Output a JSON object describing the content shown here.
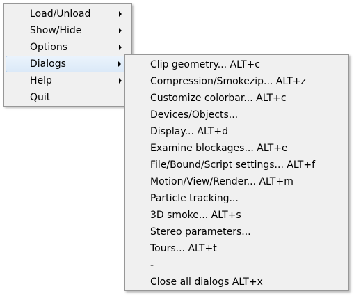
{
  "main_menu": {
    "items": [
      {
        "label": "Load/Unload",
        "has_submenu": true
      },
      {
        "label": "Show/Hide",
        "has_submenu": true
      },
      {
        "label": "Options",
        "has_submenu": true
      },
      {
        "label": "Dialogs",
        "has_submenu": true,
        "highlighted": true
      },
      {
        "label": "Help",
        "has_submenu": true
      },
      {
        "label": "Quit",
        "has_submenu": false
      }
    ]
  },
  "dialogs_submenu": {
    "items": [
      {
        "label": "Clip geometry...  ALT+c"
      },
      {
        "label": "Compression/Smokezip...  ALT+z"
      },
      {
        "label": "Customize colorbar...  ALT+c"
      },
      {
        "label": "Devices/Objects..."
      },
      {
        "label": "Display...  ALT+d"
      },
      {
        "label": "Examine blockages...  ALT+e"
      },
      {
        "label": "File/Bound/Script settings...  ALT+f"
      },
      {
        "label": "Motion/View/Render...  ALT+m"
      },
      {
        "label": "Particle tracking..."
      },
      {
        "label": "3D smoke...  ALT+s"
      },
      {
        "label": "Stereo parameters..."
      },
      {
        "label": "Tours...  ALT+t"
      },
      {
        "label": "-"
      },
      {
        "label": "Close all dialogs  ALT+x"
      }
    ]
  },
  "colors": {
    "menu_background": "#f0f0f0",
    "menu_border": "#979797",
    "highlight_background": "#dbe9f8",
    "highlight_border": "#a8c8ec"
  },
  "icons": {
    "submenu_arrow": "chevron-right-icon"
  }
}
